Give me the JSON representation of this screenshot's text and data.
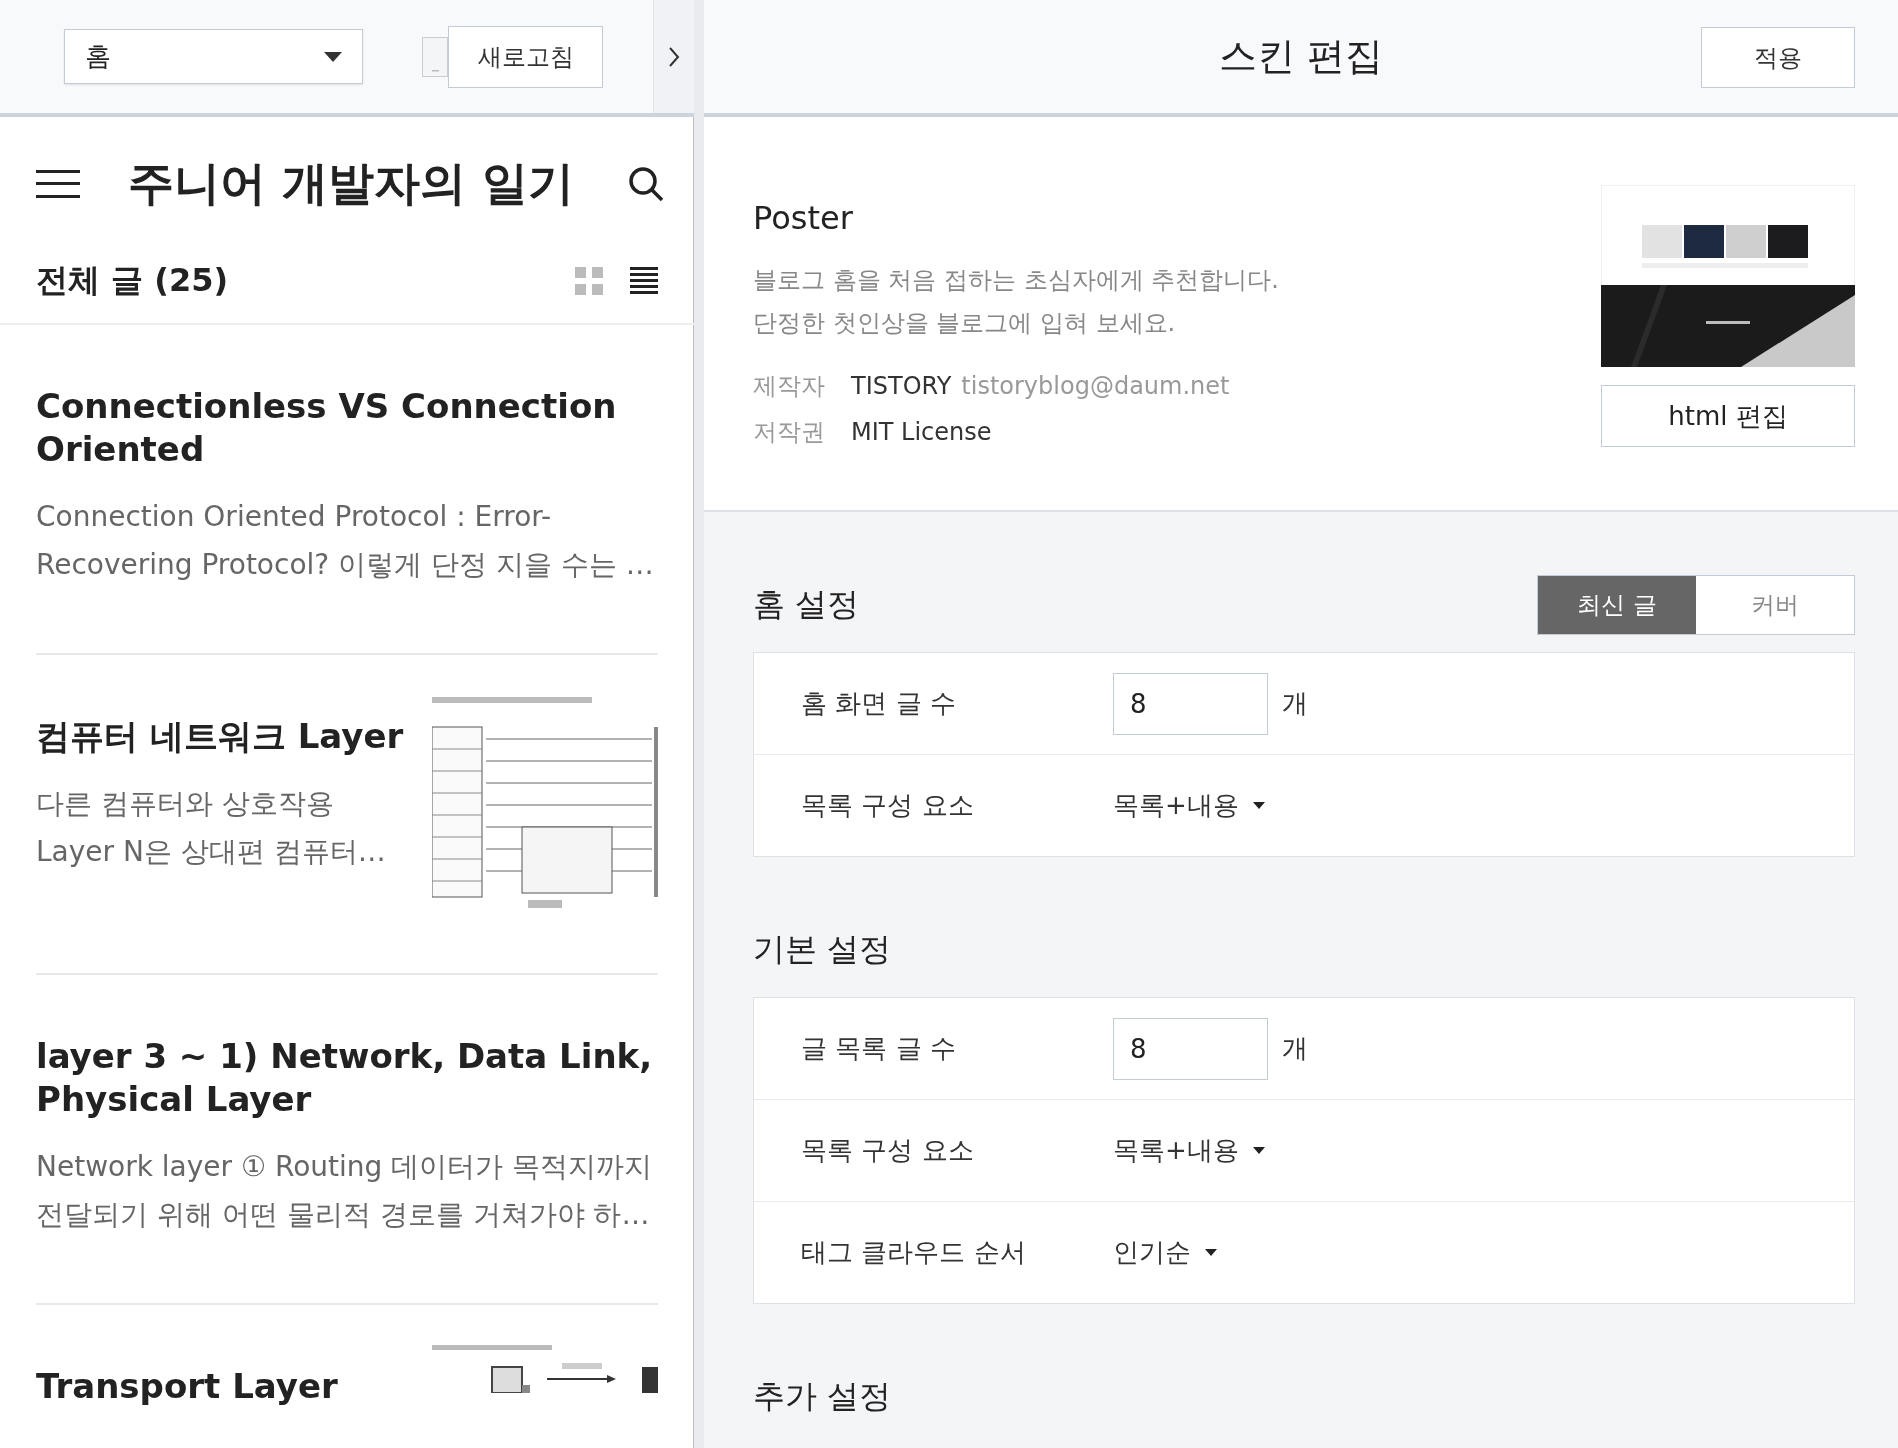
{
  "preview_toolbar": {
    "page_select": {
      "value": "홈"
    },
    "refresh_button": "새로고침"
  },
  "blog": {
    "title": "주니어 개발자의 일기",
    "list_header": {
      "label": "전체 글 (25)",
      "views": [
        {
          "kind": "grid",
          "selected": false
        },
        {
          "kind": "list",
          "selected": true
        }
      ]
    },
    "posts": [
      {
        "title": "Connectionless VS Connection Oriented",
        "excerpt_lines": [
          "Connection Oriented Protocol : Error-",
          "Recovering Protocol? 이렇게 단정 지을 수는 …"
        ]
      },
      {
        "title": "컴퓨터 네트워크 Layer",
        "excerpt_lines": [
          "다른 컴퓨터와 상호작용",
          "Layer N은 상대편 컴퓨터…"
        ],
        "thumbnail": {
          "kind": "picture"
        }
      },
      {
        "title": "layer 3 ~ 1) Network, Data Link, Physical Layer",
        "excerpt_lines": [
          "Network layer ① Routing 데이터가 목적지까지",
          "전달되기 위해 어떤 물리적 경로를 거쳐가야 하…"
        ]
      },
      {
        "title": "Transport Layer",
        "thumbnail": {
          "kind": "picture"
        }
      }
    ]
  },
  "editor": {
    "title": "스킨 편집",
    "apply_button": "적용",
    "skin": {
      "name": "Poster",
      "description": [
        "블로그 홈을 처음 접하는 초심자에게 추천합니다.",
        "단정한 첫인상을 블로그에 입혀 보세요."
      ],
      "meta": [
        {
          "label": "제작자",
          "value": "TISTORY",
          "extra": "tistoryblog@daum.net"
        },
        {
          "label": "저작권",
          "value": "MIT License"
        }
      ],
      "preview": {
        "kind": "picture"
      },
      "edit_button": "html 편집"
    },
    "sections": [
      {
        "title": "홈 설정",
        "toggle": [
          {
            "label": "최신 글",
            "selected": true
          },
          {
            "label": "커버",
            "selected": false
          }
        ],
        "rows": [
          {
            "kind": "number",
            "label": "홈 화면 글 수",
            "value": "8",
            "unit": "개"
          },
          {
            "kind": "select",
            "label": "목록 구성 요소",
            "value": "목록+내용"
          }
        ]
      },
      {
        "title": "기본 설정",
        "rows": [
          {
            "kind": "number",
            "label": "글 목록 글 수",
            "value": "8",
            "unit": "개"
          },
          {
            "kind": "select",
            "label": "목록 구성 요소",
            "value": "목록+내용"
          },
          {
            "kind": "select",
            "label": "태그 클라우드 순서",
            "value": "인기순"
          }
        ]
      },
      {
        "title": "추가 설정"
      }
    ]
  }
}
